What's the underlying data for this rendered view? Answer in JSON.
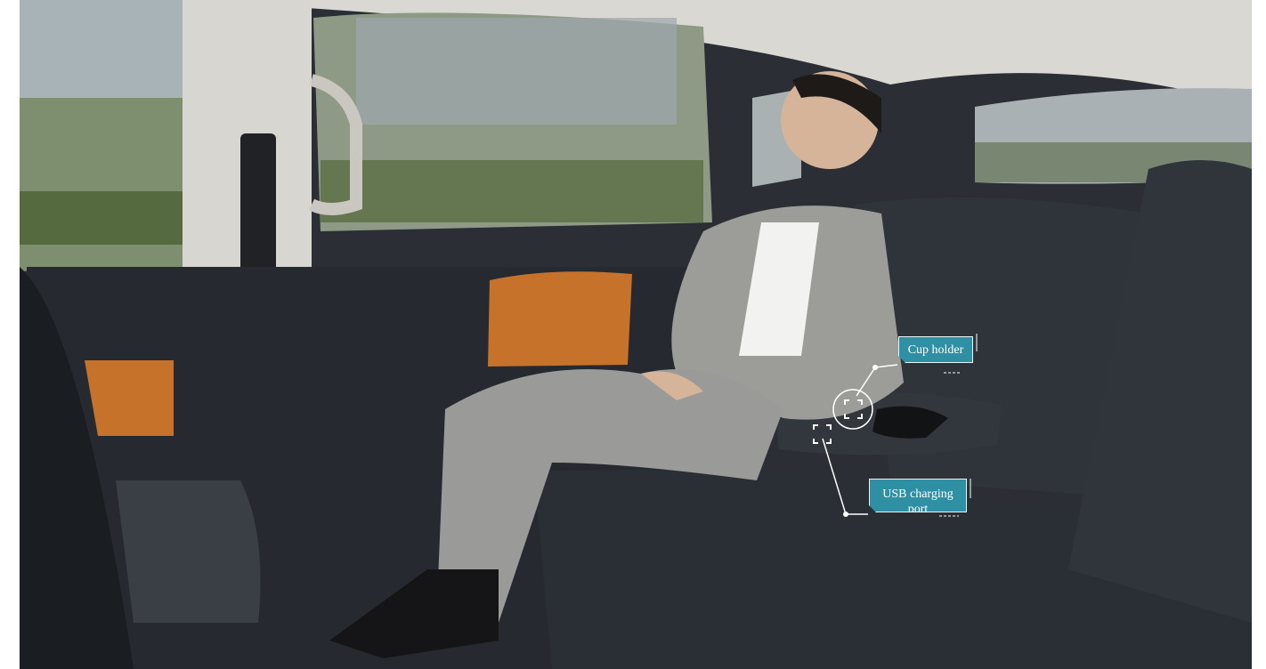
{
  "callouts": {
    "cup_holder": "Cup holder",
    "usb_line1": "USB charging",
    "usb_line2": "port"
  },
  "colors": {
    "callout_fill": "#2f8fa3",
    "upholstery": "#2a2f36",
    "accent_orange": "#c6722b",
    "suit_grey": "#9a9a98"
  }
}
